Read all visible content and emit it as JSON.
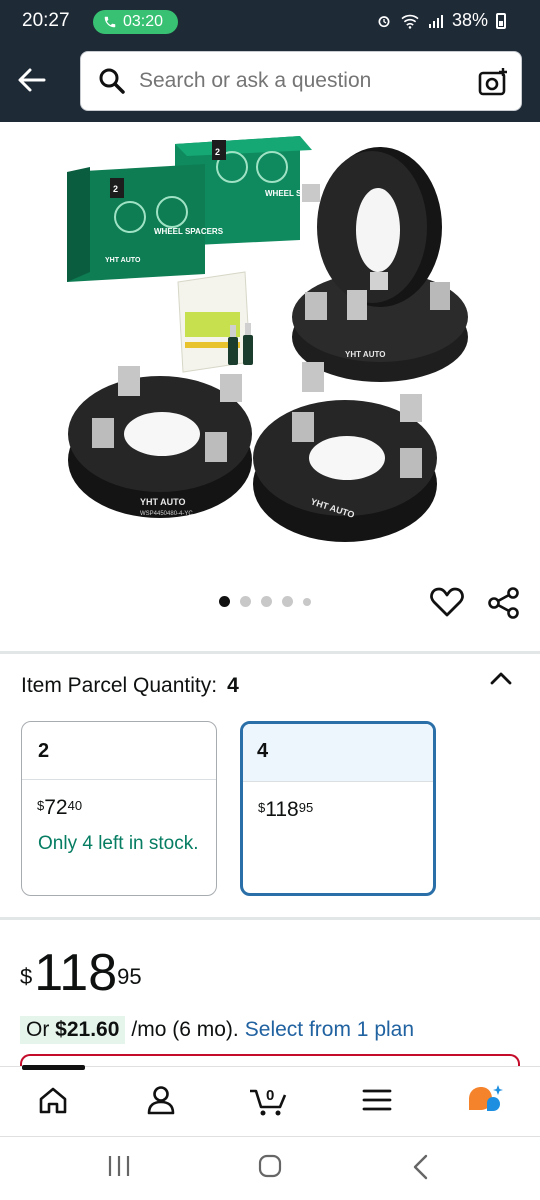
{
  "status_bar": {
    "time": "20:27",
    "call_duration": "03:20",
    "battery": "38%"
  },
  "search": {
    "placeholder": "Search or ask a question"
  },
  "product_image": {
    "box_label_1": "WHEEL SPACERS",
    "box_label_2": "WHEEL SPACERS",
    "brand": "YHT AUTO",
    "part_number": "WSP4450480-4-YC",
    "box_count": "2"
  },
  "carousel": {
    "total_dots": 5,
    "active_index": 0
  },
  "quantity": {
    "label": "Item Parcel Quantity:",
    "value": "4"
  },
  "options": [
    {
      "quantity": "2",
      "currency": "$",
      "whole": "72",
      "fraction": "40",
      "stock": "Only 4 left in stock.",
      "selected": false
    },
    {
      "quantity": "4",
      "currency": "$",
      "whole": "118",
      "fraction": "95",
      "stock": "",
      "selected": true
    }
  ],
  "price": {
    "currency": "$",
    "whole": "118",
    "fraction": "95"
  },
  "finance": {
    "prefix": "Or",
    "amount": "$21.60",
    "terms": "/mo (6 mo).",
    "link": "Select from 1 plan"
  },
  "bottom_nav": {
    "cart_count": "0"
  },
  "colors": {
    "header_bg": "#1f2a37",
    "accent_blue": "#2a6fa8",
    "stock_green": "#067d62",
    "link_blue": "#2162a1",
    "finance_bg": "#e6f5ec"
  }
}
